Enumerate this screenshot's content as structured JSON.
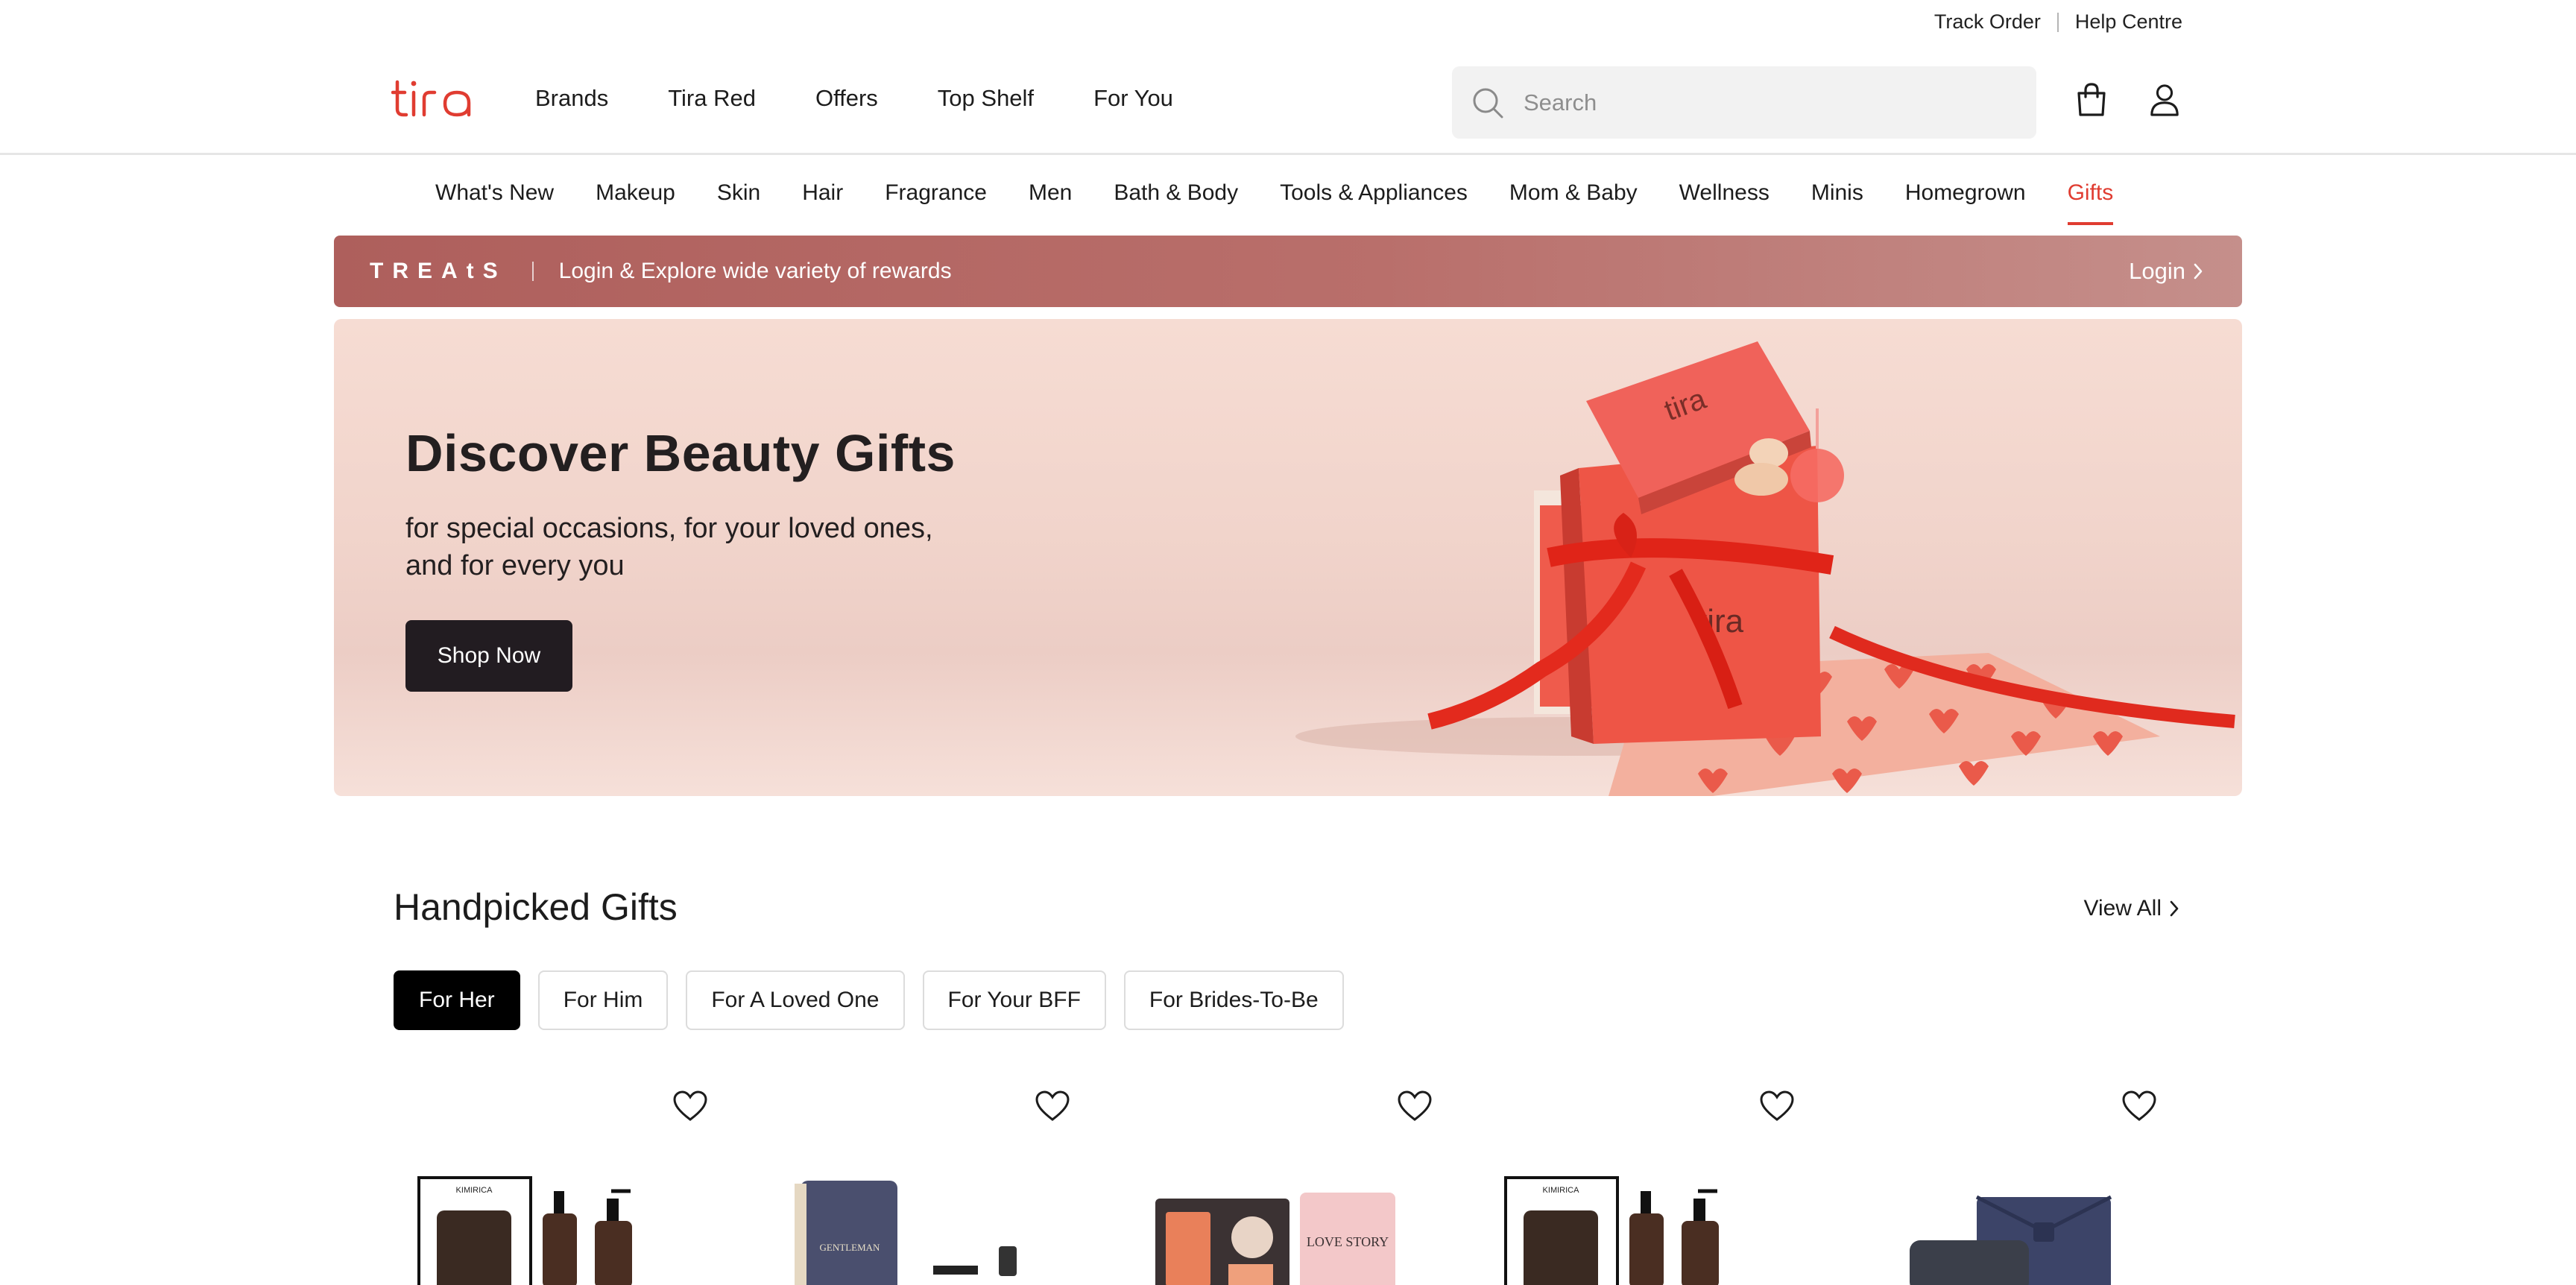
{
  "utility": {
    "track_order": "Track Order",
    "help_centre": "Help Centre"
  },
  "header": {
    "logo_text": "tira",
    "nav": [
      "Brands",
      "Tira Red",
      "Offers",
      "Top Shelf",
      "For You"
    ],
    "search_placeholder": "Search",
    "icons": {
      "search": "search-icon",
      "bag": "shopping-bag-icon",
      "account": "user-icon"
    }
  },
  "categories": {
    "items": [
      "What's New",
      "Makeup",
      "Skin",
      "Hair",
      "Fragrance",
      "Men",
      "Bath & Body",
      "Tools & Appliances",
      "Mom & Baby",
      "Wellness",
      "Minis",
      "Homegrown",
      "Gifts"
    ],
    "active": "Gifts"
  },
  "treats": {
    "brand": "TREAtS",
    "message": "Login & Explore wide variety of rewards",
    "login": "Login"
  },
  "hero": {
    "title": "Discover Beauty Gifts",
    "subtitle_line1": "for special occasions, for your loved ones,",
    "subtitle_line2": "and for every you",
    "cta": "Shop Now",
    "box_brand": "tira"
  },
  "handpicked": {
    "title": "Handpicked Gifts",
    "view_all": "View All",
    "tabs": [
      "For Her",
      "For Him",
      "For A Loved One",
      "For Your BFF",
      "For Brides-To-Be"
    ],
    "active_tab": "For Her",
    "products": [
      {
        "label": "KIMIRICA",
        "icon": "heart-icon"
      },
      {
        "label": "GENTLEMAN",
        "icon": "heart-icon"
      },
      {
        "label": "LOVE STORY",
        "icon": "heart-icon"
      },
      {
        "label": "KIMIRICA",
        "icon": "heart-icon"
      },
      {
        "label": "",
        "icon": "heart-icon"
      }
    ]
  },
  "colors": {
    "accent": "#e03c31",
    "treats_bg": "#b46865",
    "cta_bg": "#221c21",
    "hero_bg": "#f1d4cb"
  }
}
